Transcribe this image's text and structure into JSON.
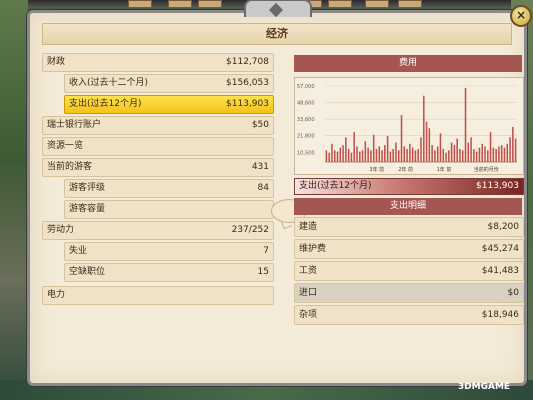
{
  "window": {
    "title": "经济",
    "close_label": "×"
  },
  "left": {
    "finance": {
      "label": "财政",
      "value": "$112,708"
    },
    "income": {
      "label": "收入(过去十二个月)",
      "value": "$156,053"
    },
    "expense": {
      "label": "支出(过去12个月)",
      "value": "$113,903"
    },
    "swiss": {
      "label": "瑞士银行账户",
      "value": "$50"
    },
    "resources": {
      "label": "资源一览"
    },
    "tourists": {
      "label": "当前的游客",
      "value": "431"
    },
    "tourist_rating": {
      "label": "游客评级",
      "value": "84"
    },
    "tourist_capacity": {
      "label": "游客容量"
    },
    "labor": {
      "label": "劳动力",
      "value": "237/252"
    },
    "unemployed": {
      "label": "失业",
      "value": "7"
    },
    "vacancies": {
      "label": "空缺职位",
      "value": "15"
    },
    "power": {
      "label": "电力"
    }
  },
  "chart": {
    "title": "费用",
    "chart_data": {
      "type": "bar",
      "y_tick_labels": [
        "57,000",
        "48,600",
        "33,600",
        "21,800",
        "10,500"
      ],
      "x_tick_labels": [
        "3年 前",
        "2年 前",
        "1年 前",
        "当前的月份"
      ],
      "values": [
        900,
        700,
        1400,
        900,
        800,
        1100,
        1300,
        1900,
        1000,
        700,
        2300,
        1200,
        800,
        900,
        1600,
        1100,
        900,
        2100,
        1000,
        1200,
        900,
        1300,
        2000,
        800,
        1000,
        1500,
        900,
        3600,
        1200,
        1000,
        1400,
        1100,
        900,
        1000,
        1900,
        5100,
        3100,
        2600,
        1300,
        900,
        1200,
        2200,
        1000,
        700,
        900,
        1500,
        1300,
        1800,
        1000,
        900,
        5700,
        1500,
        1900,
        1000,
        800,
        1100,
        1400,
        1200,
        900,
        2300,
        1100,
        1000,
        1200,
        1300,
        1100,
        1400,
        1900,
        2700,
        1800
      ],
      "ylim": [
        0,
        6000
      ]
    }
  },
  "spend": {
    "label": "支出(过去12个月)",
    "value": "$113,903"
  },
  "details": {
    "title": "支出明细",
    "rows": [
      {
        "label": "建造",
        "value": "$8,200"
      },
      {
        "label": "维护费",
        "value": "$45,274"
      },
      {
        "label": "工资",
        "value": "$41,483"
      },
      {
        "label": "进口",
        "value": "$0"
      },
      {
        "label": "杂项",
        "value": "$18,946"
      }
    ]
  },
  "watermark": "3DMGAME",
  "colors": {
    "highlight": "#f4c21a",
    "bar": "#c0504d",
    "accent": "#a45652"
  }
}
